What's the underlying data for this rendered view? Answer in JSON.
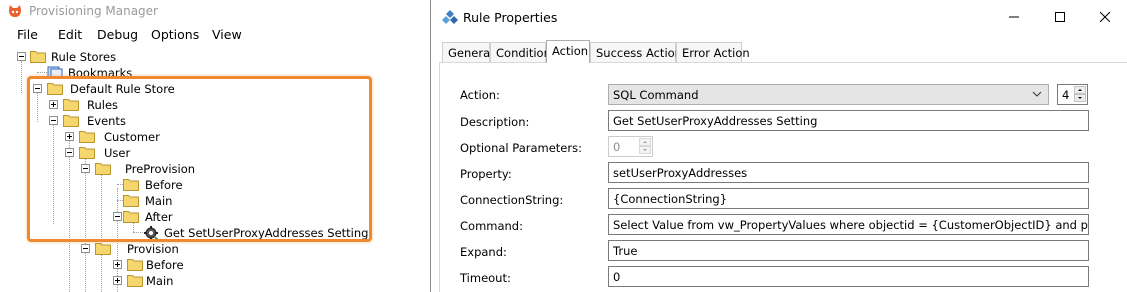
{
  "main_window": {
    "title": "Provisioning Manager",
    "menu": [
      "File",
      "Edit",
      "Debug",
      "Options",
      "View"
    ]
  },
  "tree": {
    "rule_stores": "Rule Stores",
    "bookmarks": "Bookmarks",
    "default_rule_store": "Default Rule Store",
    "rules": "Rules",
    "events": "Events",
    "customer": "Customer",
    "user": "User",
    "preprovision": "PreProvision",
    "before": "Before",
    "main": "Main",
    "after": "After",
    "rule_item": "Get SetUserProxyAddresses Setting",
    "provision": "Provision",
    "provision_before": "Before",
    "provision_main": "Main"
  },
  "dialog": {
    "title": "Rule Properties",
    "tabs": [
      "General",
      "Condition",
      "Action",
      "Success Action",
      "Error Action"
    ],
    "active_tab": "Action",
    "labels": {
      "action": "Action:",
      "description": "Description:",
      "optional_parameters": "Optional Parameters:",
      "property": "Property:",
      "connection_string": "ConnectionString:",
      "command": "Command:",
      "expand": "Expand:",
      "timeout": "Timeout:"
    },
    "values": {
      "action": "SQL Command",
      "action_order": "4",
      "description": "Get SetUserProxyAddresses Setting",
      "optional_parameters": "0",
      "property": "setUserProxyAddresses",
      "connection_string": "{ConnectionString}",
      "command": "Select Value from vw_PropertyValues where objectid = {CustomerObjectID} and property = 'setUserProxyAddresses'",
      "expand": "True",
      "timeout": "0"
    }
  },
  "colors": {
    "highlight": "#f0882e",
    "folder": "#f5d76e",
    "title_inactive": "#9a9a9a"
  }
}
